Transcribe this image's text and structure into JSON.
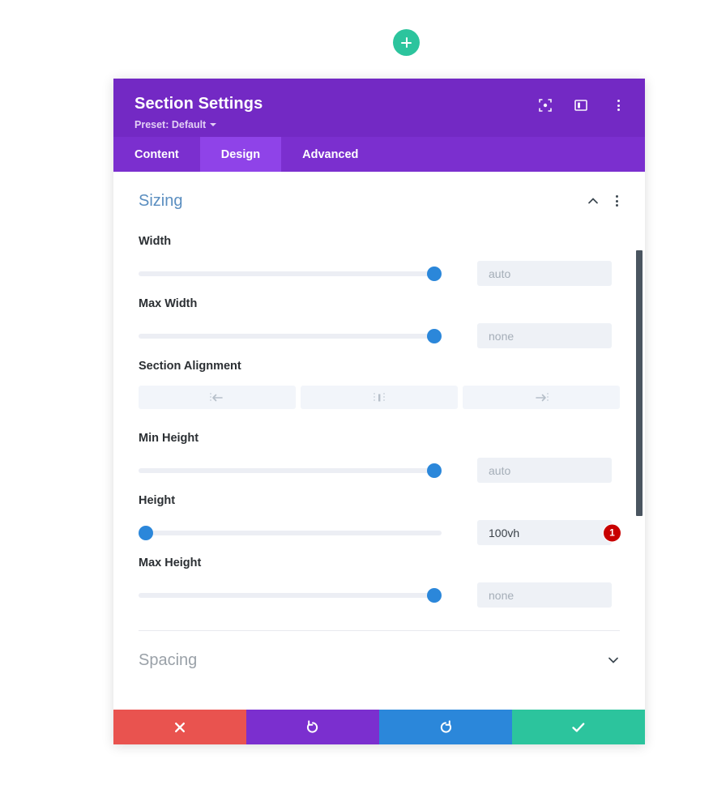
{
  "canvas": {
    "add_button": {
      "icon": "plus-icon",
      "label": ""
    }
  },
  "modal": {
    "header": {
      "title": "Section Settings",
      "preset_label": "Preset: Default",
      "icons": [
        {
          "name": "focus-icon"
        },
        {
          "name": "layout-panel-icon"
        },
        {
          "name": "kebab-menu-icon"
        }
      ]
    },
    "tabs": [
      {
        "label": "Content",
        "active": false
      },
      {
        "label": "Design",
        "active": true
      },
      {
        "label": "Advanced",
        "active": false
      }
    ],
    "sections": [
      {
        "title": "Sizing",
        "expanded": true,
        "fields": [
          {
            "label": "Width",
            "type": "slider",
            "value": "auto",
            "filled": false,
            "knob_percent": 98
          },
          {
            "label": "Max Width",
            "type": "slider",
            "value": "none",
            "filled": false,
            "knob_percent": 98
          },
          {
            "label": "Section Alignment",
            "type": "buttons",
            "options": [
              "align-left",
              "align-center",
              "align-right"
            ]
          },
          {
            "label": "Min Height",
            "type": "slider",
            "value": "auto",
            "filled": false,
            "knob_percent": 98
          },
          {
            "label": "Height",
            "type": "slider",
            "value": "100vh",
            "filled": true,
            "knob_percent": 0,
            "badge": "1"
          },
          {
            "label": "Max Height",
            "type": "slider",
            "value": "none",
            "filled": false,
            "knob_percent": 98
          }
        ]
      },
      {
        "title": "Spacing",
        "expanded": false,
        "fields": []
      }
    ],
    "footer": [
      {
        "name": "cancel",
        "icon": "close-icon"
      },
      {
        "name": "undo",
        "icon": "undo-icon"
      },
      {
        "name": "redo",
        "icon": "redo-icon"
      },
      {
        "name": "save",
        "icon": "check-icon"
      }
    ]
  },
  "colors": {
    "header_purple": "#7329c4",
    "tab_bar_purple": "#7b2fcf",
    "tab_active_purple": "#8f43e8",
    "section_title_blue": "#5a8ec0",
    "slider_blue": "#2b87da",
    "badge_red": "#c80000",
    "cancel_red": "#e9534f",
    "save_green": "#2cc49d",
    "redo_blue": "#2b87da",
    "scrollbar_dark": "#4a5560"
  }
}
